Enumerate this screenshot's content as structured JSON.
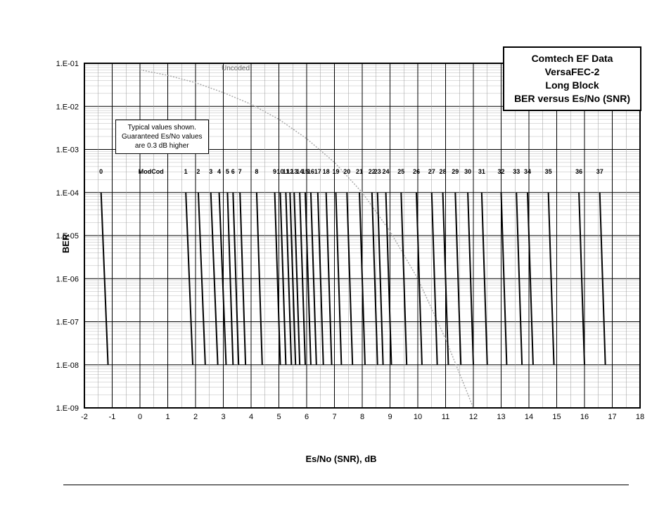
{
  "chart_data": {
    "type": "line",
    "title_lines": [
      "Comtech EF Data",
      "VersaFEC-2",
      "Long Block",
      "BER versus Es/No (SNR)"
    ],
    "note_lines": [
      "Typical values shown.",
      "Guaranteed Es/No values",
      "are 0.3 dB higher"
    ],
    "uncoded_label": "Uncoded",
    "modcod_label": "ModCod",
    "xlabel": "Es/No (SNR), dB",
    "ylabel": "BER",
    "xlim": [
      -2,
      18
    ],
    "ylim_exp": [
      -9,
      -1
    ],
    "x_ticks": [
      -2,
      -1,
      0,
      1,
      2,
      3,
      4,
      5,
      6,
      7,
      8,
      9,
      10,
      11,
      12,
      13,
      14,
      15,
      16,
      17,
      18
    ],
    "y_tick_labels": [
      "1.E-01",
      "1.E-02",
      "1.E-03",
      "1.E-04",
      "1.E-05",
      "1.E-06",
      "1.E-07",
      "1.E-08",
      "1.E-09"
    ],
    "uncoded_curve": [
      {
        "x": 0.0,
        "y_exp": -1.15
      },
      {
        "x": 1.0,
        "y_exp": -1.28
      },
      {
        "x": 2.0,
        "y_exp": -1.45
      },
      {
        "x": 3.0,
        "y_exp": -1.68
      },
      {
        "x": 4.0,
        "y_exp": -1.95
      },
      {
        "x": 5.0,
        "y_exp": -2.3
      },
      {
        "x": 6.0,
        "y_exp": -2.75
      },
      {
        "x": 7.0,
        "y_exp": -3.3
      },
      {
        "x": 8.0,
        "y_exp": -4.0
      },
      {
        "x": 9.0,
        "y_exp": -4.9
      },
      {
        "x": 10.0,
        "y_exp": -6.0
      },
      {
        "x": 11.0,
        "y_exp": -7.4
      },
      {
        "x": 12.0,
        "y_exp": -9.0
      }
    ],
    "series": [
      {
        "name": "0",
        "x_top": -1.4,
        "x_bot": -1.15
      },
      {
        "name": "1",
        "x_top": 1.65,
        "x_bot": 1.9
      },
      {
        "name": "2",
        "x_top": 2.1,
        "x_bot": 2.35
      },
      {
        "name": "3",
        "x_top": 2.55,
        "x_bot": 2.8
      },
      {
        "name": "4",
        "x_top": 2.85,
        "x_bot": 3.1
      },
      {
        "name": "5",
        "x_top": 3.15,
        "x_bot": 3.35
      },
      {
        "name": "6",
        "x_top": 3.35,
        "x_bot": 3.55
      },
      {
        "name": "7",
        "x_top": 3.6,
        "x_bot": 3.8
      },
      {
        "name": "8",
        "x_top": 4.2,
        "x_bot": 4.4
      },
      {
        "name": "9",
        "x_top": 4.85,
        "x_bot": 5.05
      },
      {
        "name": "10",
        "x_top": 5.05,
        "x_bot": 5.25
      },
      {
        "name": "11",
        "x_top": 5.25,
        "x_bot": 5.45
      },
      {
        "name": "12",
        "x_top": 5.4,
        "x_bot": 5.6
      },
      {
        "name": "13",
        "x_top": 5.55,
        "x_bot": 5.75
      },
      {
        "name": "14",
        "x_top": 5.75,
        "x_bot": 5.95
      },
      {
        "name": "15",
        "x_top": 5.95,
        "x_bot": 6.15
      },
      {
        "name": "16",
        "x_top": 6.15,
        "x_bot": 6.35
      },
      {
        "name": "17",
        "x_top": 6.4,
        "x_bot": 6.6
      },
      {
        "name": "18",
        "x_top": 6.7,
        "x_bot": 6.9
      },
      {
        "name": "19",
        "x_top": 7.05,
        "x_bot": 7.25
      },
      {
        "name": "20",
        "x_top": 7.45,
        "x_bot": 7.65
      },
      {
        "name": "21",
        "x_top": 7.9,
        "x_bot": 8.1
      },
      {
        "name": "22",
        "x_top": 8.35,
        "x_bot": 8.55
      },
      {
        "name": "23",
        "x_top": 8.55,
        "x_bot": 8.75
      },
      {
        "name": "24",
        "x_top": 8.85,
        "x_bot": 9.05
      },
      {
        "name": "25",
        "x_top": 9.4,
        "x_bot": 9.6
      },
      {
        "name": "26",
        "x_top": 9.95,
        "x_bot": 10.15
      },
      {
        "name": "27",
        "x_top": 10.5,
        "x_bot": 10.7
      },
      {
        "name": "28",
        "x_top": 10.9,
        "x_bot": 11.1
      },
      {
        "name": "29",
        "x_top": 11.35,
        "x_bot": 11.55
      },
      {
        "name": "30",
        "x_top": 11.8,
        "x_bot": 12.0
      },
      {
        "name": "31",
        "x_top": 12.3,
        "x_bot": 12.5
      },
      {
        "name": "32",
        "x_top": 13.0,
        "x_bot": 13.2
      },
      {
        "name": "33",
        "x_top": 13.55,
        "x_bot": 13.75
      },
      {
        "name": "34",
        "x_top": 13.95,
        "x_bot": 14.15
      },
      {
        "name": "35",
        "x_top": 14.7,
        "x_bot": 14.9
      },
      {
        "name": "36",
        "x_top": 15.8,
        "x_bot": 16.0
      },
      {
        "name": "37",
        "x_top": 16.55,
        "x_bot": 16.75
      }
    ]
  }
}
